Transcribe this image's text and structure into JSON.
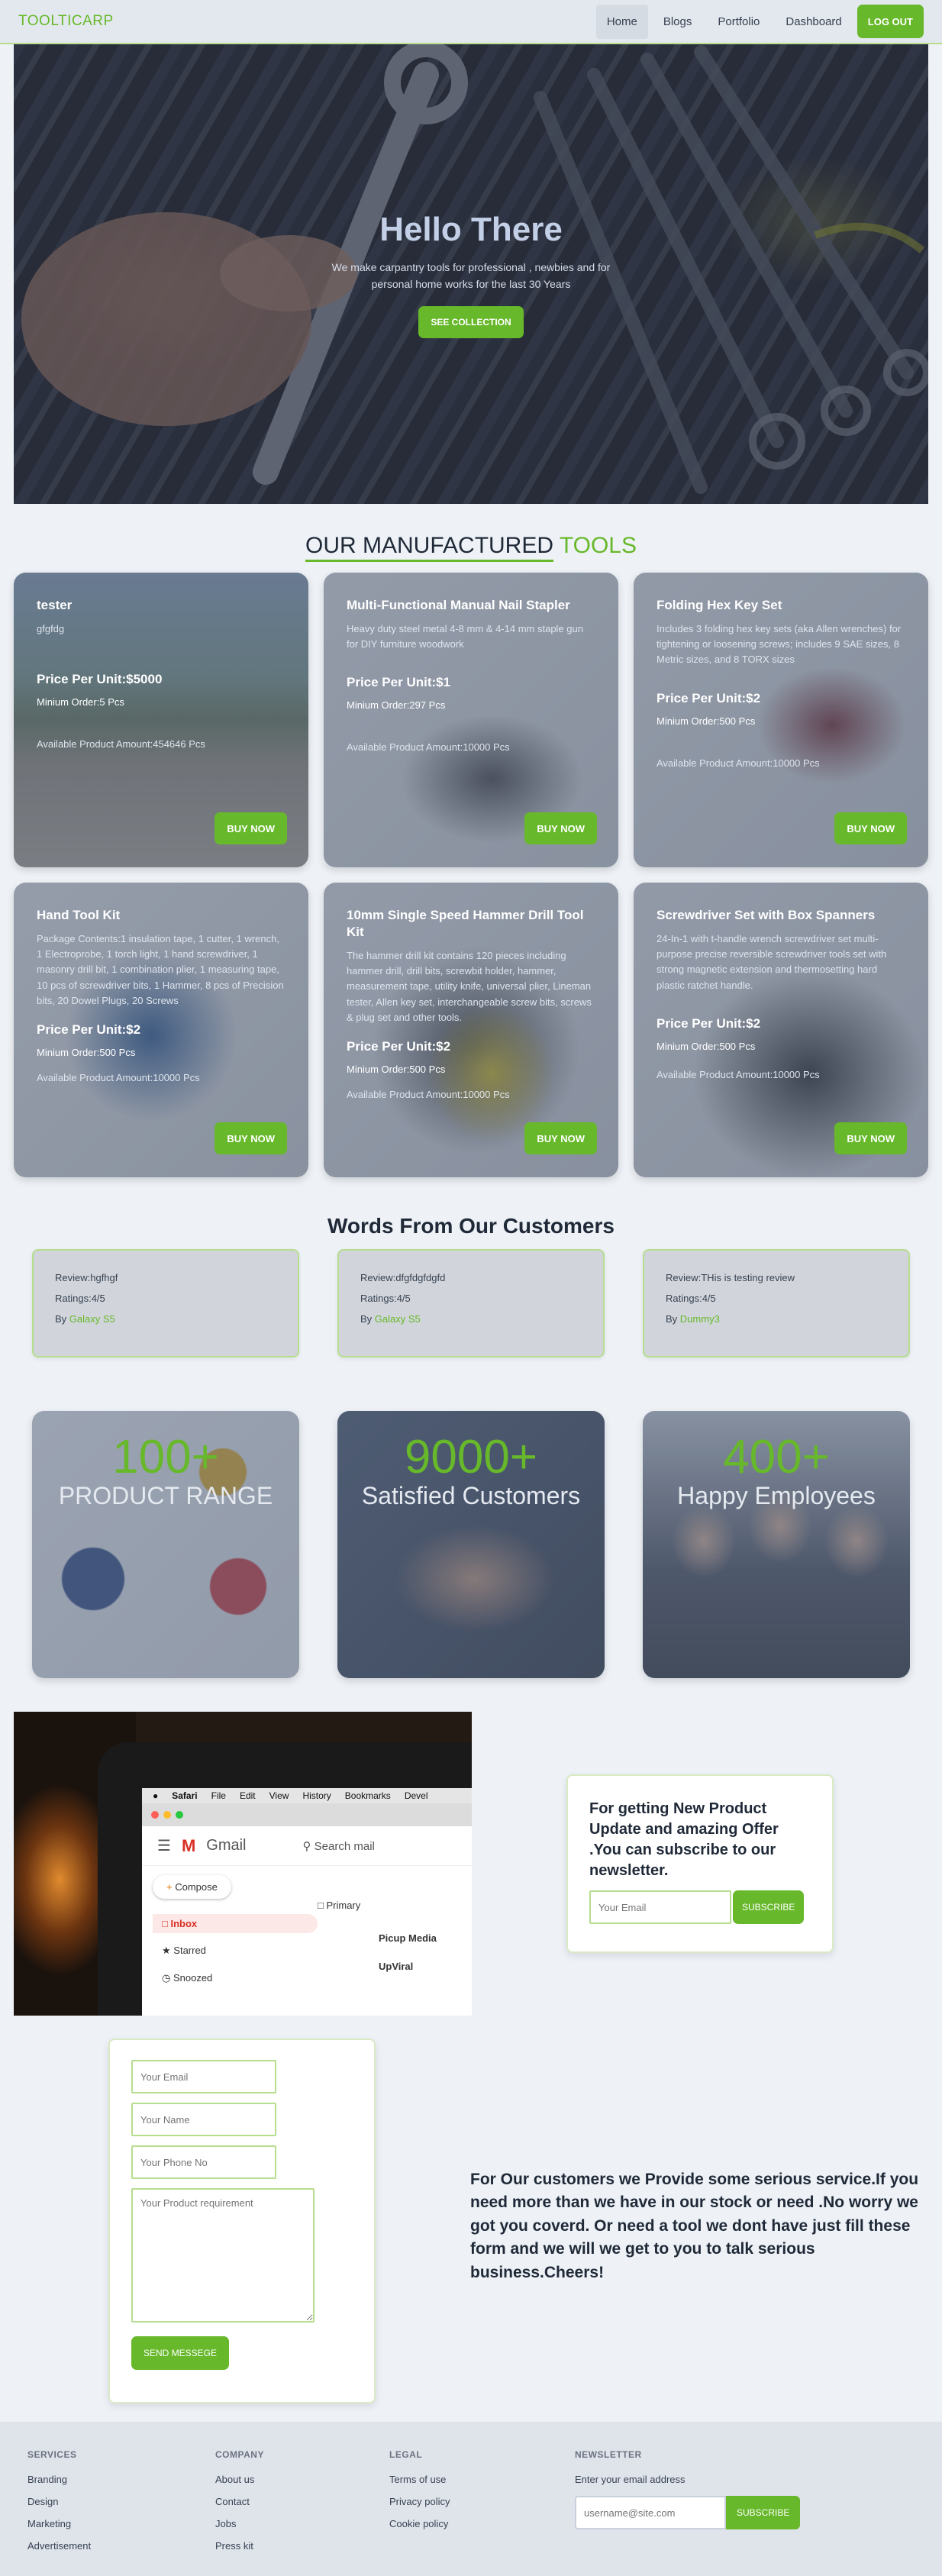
{
  "nav": {
    "logo": "TOOLTICARP",
    "links": [
      "Home",
      "Blogs",
      "Portfolio",
      "Dashboard"
    ],
    "logout": "LOG OUT"
  },
  "hero": {
    "title": "Hello There",
    "text": "We make carpantry tools for professional , newbies and for personal home works for the last 30 Years",
    "button": "SEE COLLECTION"
  },
  "products_section": {
    "title_part1": "OUR MANUFACTURED",
    "title_part2": "TOOLS"
  },
  "products": [
    {
      "name": "tester",
      "description": "gfgfdg",
      "price": "Price Per Unit:$5000",
      "min_order": "Minium Order:5 Pcs",
      "available": "Available Product Amount:454646 Pcs",
      "button": "BUY NOW"
    },
    {
      "name": "Multi-Functional Manual Nail Stapler",
      "description": "Heavy duty steel metal 4-8 mm & 4-14 mm staple gun for DIY furniture woodwork",
      "price": "Price Per Unit:$1",
      "min_order": "Minium Order:297 Pcs",
      "available": "Available Product Amount:10000 Pcs",
      "button": "BUY NOW"
    },
    {
      "name": "Folding Hex Key Set",
      "description": "Includes 3 folding hex key sets (aka Allen wrenches) for tightening or loosening screws; includes 9 SAE sizes, 8 Metric sizes, and 8 TORX sizes",
      "price": "Price Per Unit:$2",
      "min_order": "Minium Order:500 Pcs",
      "available": "Available Product Amount:10000 Pcs",
      "button": "BUY NOW"
    },
    {
      "name": "Hand Tool Kit",
      "description": "Package Contents:1 insulation tape, 1 cutter, 1 wrench, 1 Electroprobe, 1 torch light, 1 hand screwdriver, 1 masonry drill bit, 1 combination plier, 1 measuring tape, 10 pcs of screwdriver bits, 1 Hammer, 8 pcs of Precision bits, 20 Dowel Plugs, 20 Screws",
      "price": "Price Per Unit:$2",
      "min_order": "Minium Order:500 Pcs",
      "available": "Available Product Amount:10000 Pcs",
      "button": "BUY NOW"
    },
    {
      "name": "10mm Single Speed Hammer Drill Tool Kit",
      "description": "The hammer drill kit contains 120 pieces including hammer drill, drill bits, screwbit holder, hammer, measurement tape, utility knife, universal plier, Lineman tester, Allen key set, interchangeable screw bits, screws & plug set and other tools.",
      "price": "Price Per Unit:$2",
      "min_order": "Minium Order:500 Pcs",
      "available": "Available Product Amount:10000 Pcs",
      "button": "BUY NOW"
    },
    {
      "name": "Screwdriver Set with Box Spanners",
      "description": "24-In-1 with t-handle wrench screwdriver set multi-purpose precise reversible screwdriver tools set with strong magnetic extension and thermosetting hard plastic ratchet handle.",
      "price": "Price Per Unit:$2",
      "min_order": "Minium Order:500 Pcs",
      "available": "Available Product Amount:10000 Pcs",
      "button": "BUY NOW"
    }
  ],
  "reviews_section": {
    "title": "Words From Our Customers"
  },
  "reviews": [
    {
      "review": "Review:hgfhgf",
      "ratings": "Ratings:4/5",
      "by": "By",
      "name": "Galaxy S5"
    },
    {
      "review": "Review:dfgfdgfdgfd",
      "ratings": "Ratings:4/5",
      "by": "By",
      "name": "Galaxy S5"
    },
    {
      "review": "Review:THis is testing review",
      "ratings": "Ratings:4/5",
      "by": "By",
      "name": "Dummy3"
    }
  ],
  "stats": [
    {
      "number": "100+",
      "label": "PRODUCT RANGE"
    },
    {
      "number": "9000+",
      "label": "Satisfied Customers"
    },
    {
      "number": "400+",
      "label": "Happy Employees"
    }
  ],
  "newsletter_image": {
    "menu": [
      "Safari",
      "File",
      "Edit",
      "View",
      "History",
      "Bookmarks",
      "Devel"
    ],
    "gmail": "Gmail",
    "search": "Search mail",
    "compose": "Compose",
    "inbox": "Inbox",
    "starred": "Starred",
    "snoozed": "Snoozed",
    "primary": "Primary",
    "mail1": "Picup Media",
    "mail2": "UpViral"
  },
  "newsletter": {
    "title": "For getting New Product Update and amazing Offer .You can subscribe to our newsletter.",
    "email_placeholder": "Your Email",
    "button": "SUBSCRIBE"
  },
  "contact": {
    "email_placeholder": "Your Email",
    "name_placeholder": "Your Name",
    "phone_placeholder": "Your Phone No",
    "requirement_placeholder": "Your Product requirement",
    "button": "SEND MESSEGE",
    "text": "For Our customers we Provide some serious service.If you need more than we have in our stock or need .No worry we got you coverd. Or need a tool we dont have just fill these form and we will we get to you to talk serious business.Cheers!"
  },
  "footer": {
    "services": {
      "title": "SERVICES",
      "links": [
        "Branding",
        "Design",
        "Marketing",
        "Advertisement"
      ]
    },
    "company": {
      "title": "COMPANY",
      "links": [
        "About us",
        "Contact",
        "Jobs",
        "Press kit"
      ]
    },
    "legal": {
      "title": "LEGAL",
      "links": [
        "Terms of use",
        "Privacy policy",
        "Cookie policy"
      ]
    },
    "newsletter": {
      "title": "NEWSLETTER",
      "label": "Enter your email address",
      "placeholder": "username@site.com",
      "button": "SUBSCRIBE"
    }
  },
  "colors": {
    "accent": "#67b82a",
    "overlay": "#5f6c82",
    "background": "#eef2f7"
  }
}
